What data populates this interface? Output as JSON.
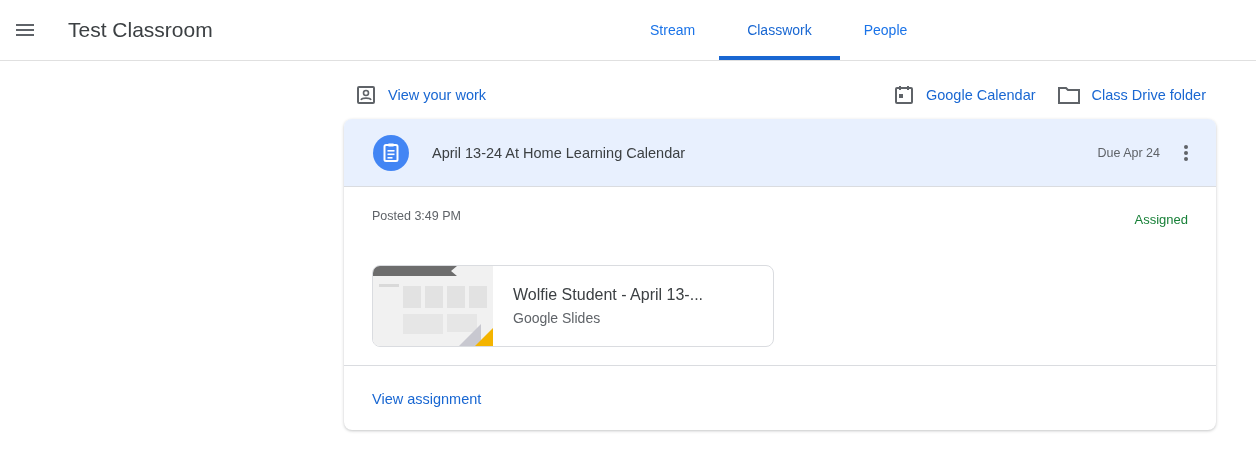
{
  "header": {
    "title": "Test Classroom"
  },
  "tabs": [
    {
      "label": "Stream",
      "selected": false
    },
    {
      "label": "Classwork",
      "selected": true
    },
    {
      "label": "People",
      "selected": false
    }
  ],
  "toolbar": {
    "view_work": "View your work",
    "calendar": "Google Calendar",
    "drive": "Class Drive folder"
  },
  "assignment": {
    "title": "April 13-24 At Home Learning Calendar",
    "due": "Due Apr 24",
    "posted": "Posted 3:49 PM",
    "status": "Assigned",
    "attachment": {
      "title": "Wolfie Student - April 13-...",
      "type": "Google Slides"
    },
    "footer_link": "View assignment"
  }
}
